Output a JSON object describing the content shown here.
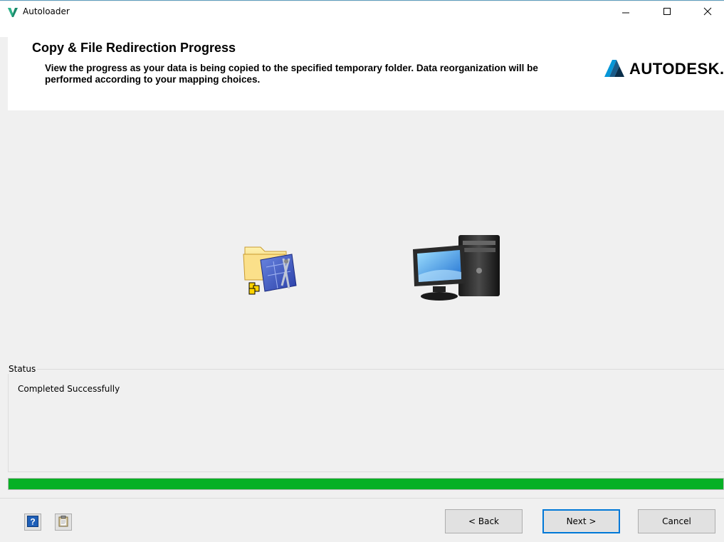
{
  "window": {
    "title": "Autoloader",
    "app_icon": "autodesk-vault-v-icon",
    "controls": [
      "minimize-icon",
      "maximize-icon",
      "close-icon"
    ]
  },
  "header": {
    "title": "Copy & File Redirection Progress",
    "description": "View the progress as your data is being copied to the specified temporary folder. Data reorganization will be performed according to your mapping choices.",
    "brand_text": "AUTODESK."
  },
  "center": {
    "source_icon": "folder-with-drawings-icon",
    "target_icon": "desktop-computer-icon"
  },
  "status": {
    "legend": "Status",
    "text": "Completed Successfully"
  },
  "progress": {
    "fraction": 1.0,
    "color": "#06b025"
  },
  "footer": {
    "help_icon": "help-icon",
    "report_icon": "clipboard-icon",
    "back_label": "< Back",
    "next_label": "Next >",
    "cancel_label": "Cancel"
  }
}
